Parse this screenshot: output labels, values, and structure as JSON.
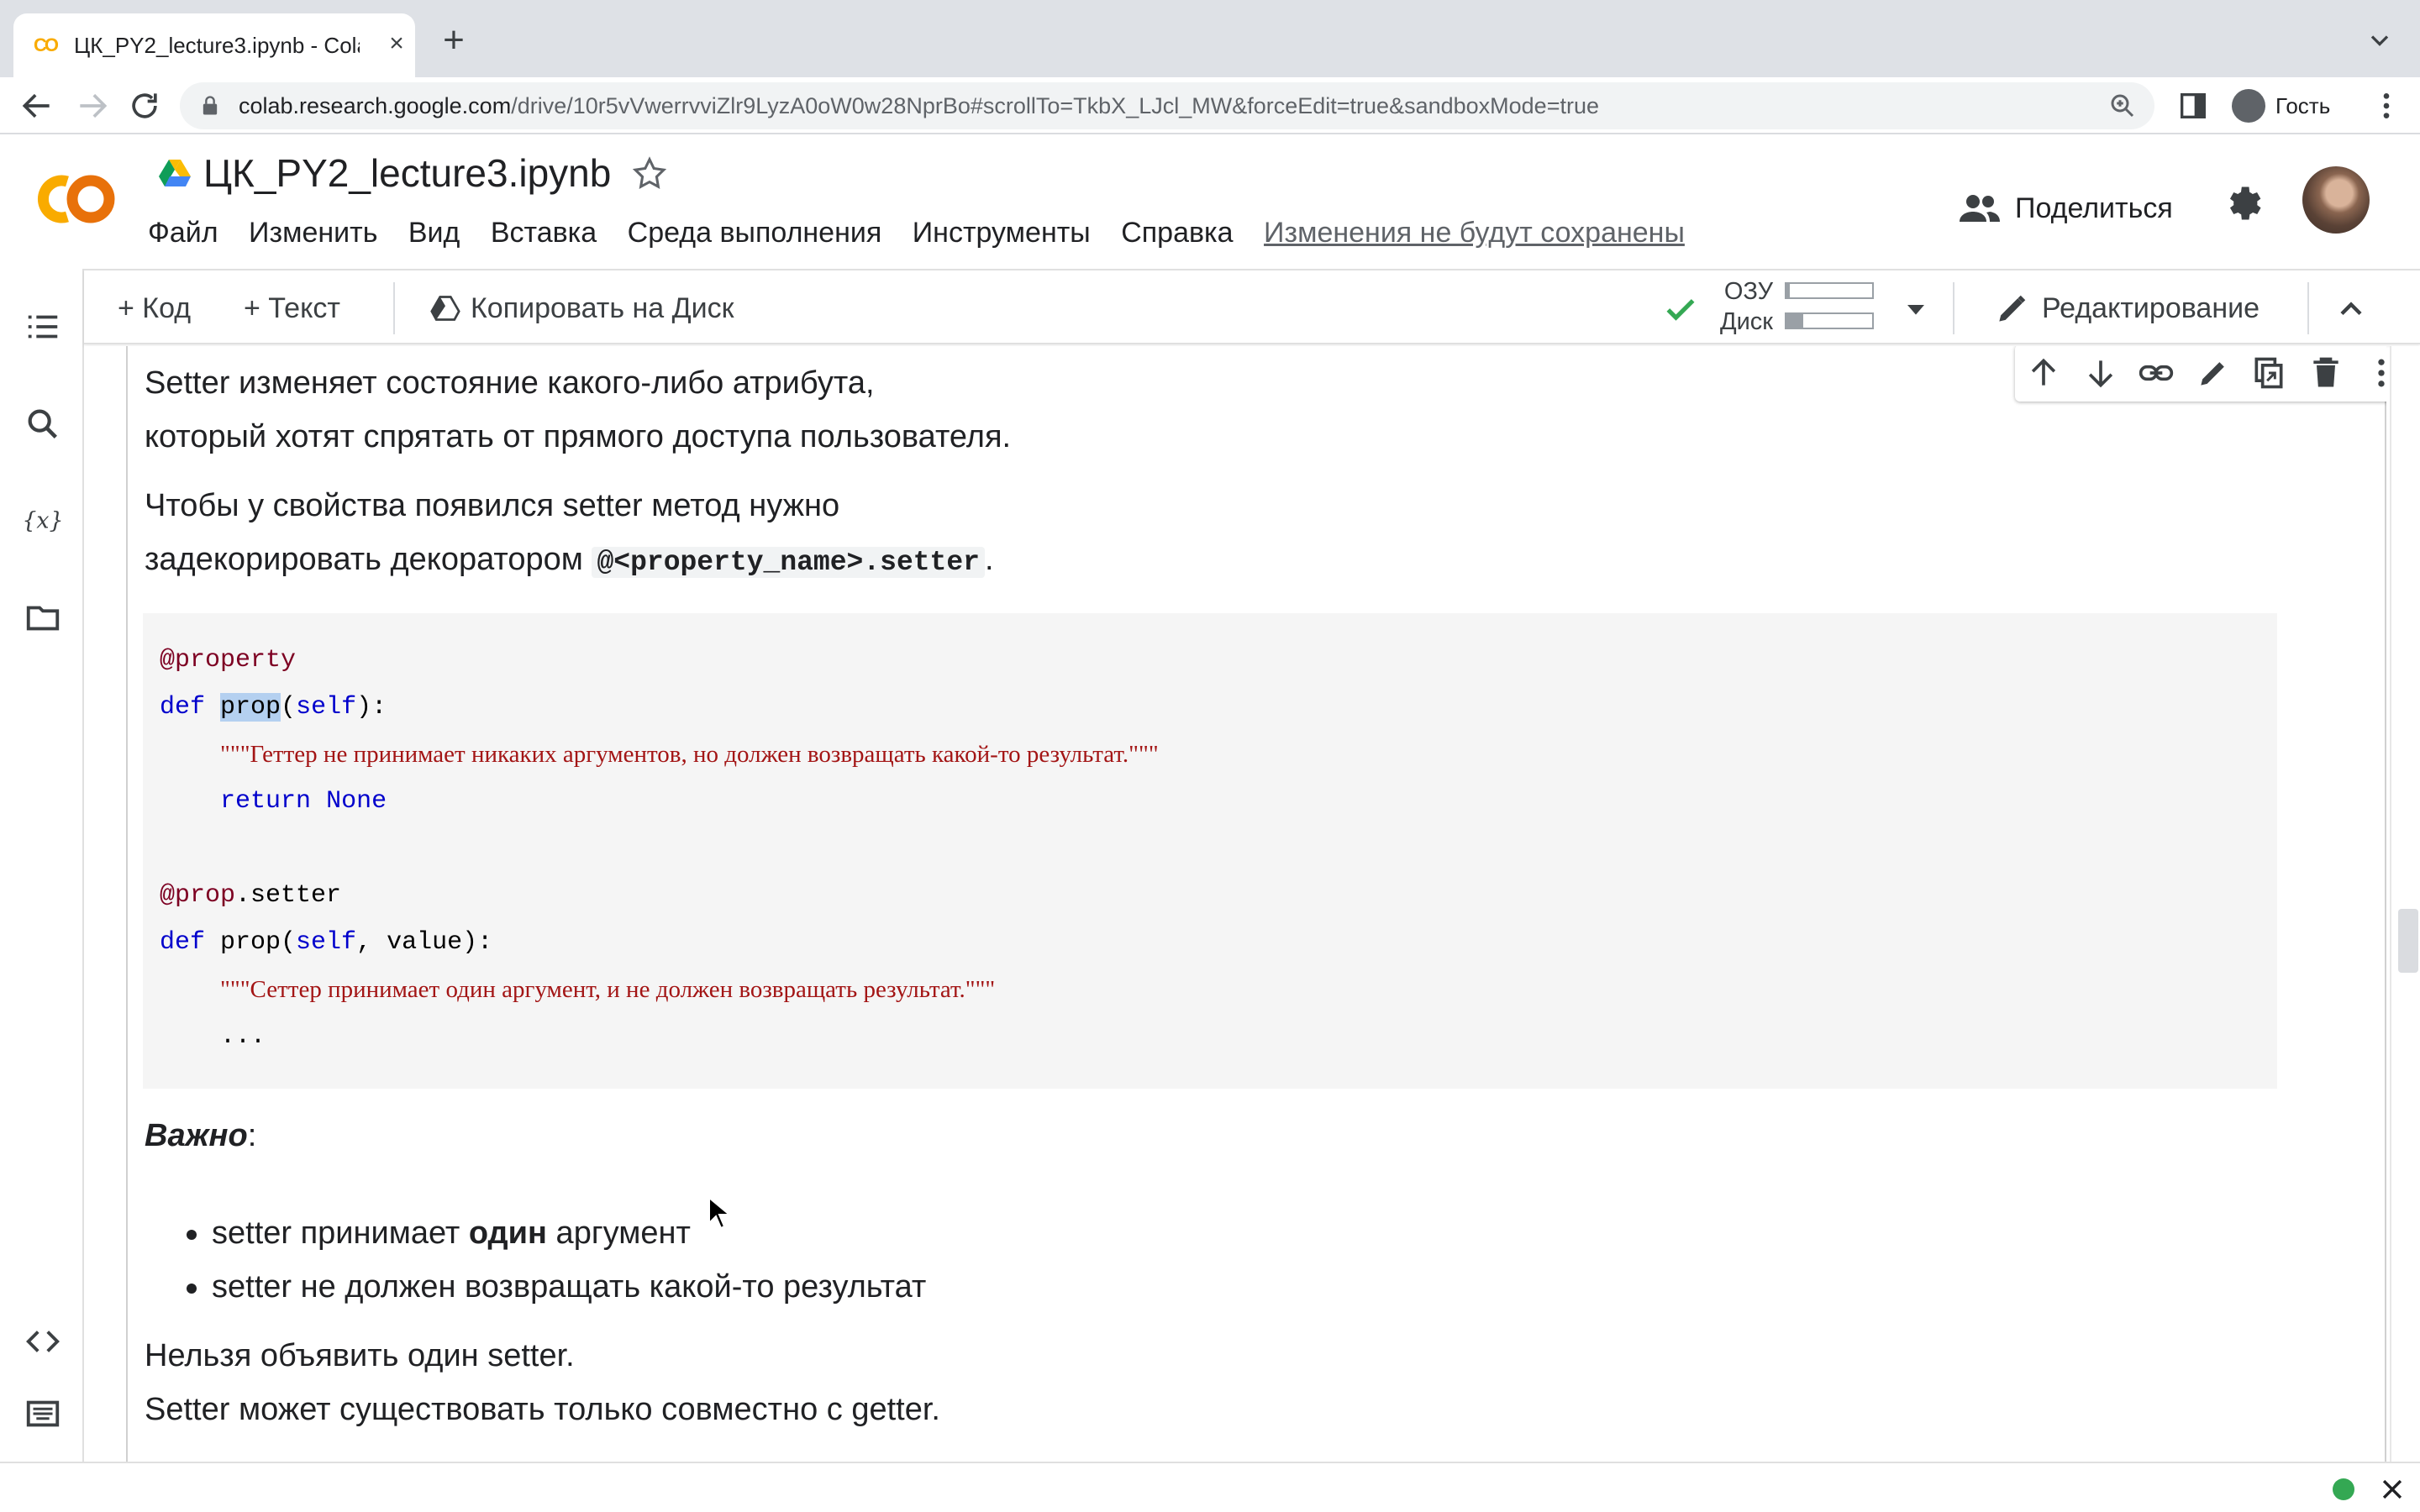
{
  "browser": {
    "tab_title": "ЦК_PY2_lecture3.ipynb - Cola",
    "url_host": "colab.research.google.com",
    "url_path": "/drive/10r5vVwerrvviZlr9LyzA0oW0w28NprBo#scrollTo=TkbX_LJcl_MW&forceEdit=true&sandboxMode=true",
    "profile_label": "Гость"
  },
  "colab": {
    "logo_text": "CO",
    "notebook_title": "ЦК_PY2_lecture3.ipynb",
    "menu": [
      "Файл",
      "Изменить",
      "Вид",
      "Вставка",
      "Среда выполнения",
      "Инструменты",
      "Справка"
    ],
    "unsaved_notice": "Изменения не будут сохранены",
    "share_label": "Поделиться"
  },
  "toolbar": {
    "add_code": "+ Код",
    "add_text": "+ Текст",
    "copy_to_drive": "Копировать на Диск",
    "ram_label": "ОЗУ",
    "disk_label": "Диск",
    "ram_usage": 0.04,
    "disk_usage": 0.2,
    "edit_mode": "Редактирование"
  },
  "cell": {
    "p1_line1": "Setter изменяет состояние какого-либо атрибута,",
    "p1_line2": "который хотят спрятать от прямого доступа пользователя.",
    "p2_line1": "Чтобы у свойства появился setter метод нужно",
    "p2_line2_prefix": "задекорировать декоратором ",
    "p2_code": "@<property_name>.setter",
    "p2_suffix": ".",
    "code": {
      "l1_deco": "@property",
      "l2_def": "def",
      "l2_name": "prop",
      "l2_paren_open": "(",
      "l2_self": "self",
      "l2_rest": "):",
      "l3_doc": "\"\"\"Геттер не принимает никаких аргументов, но должен возвращать какой-то результат.\"\"\"",
      "l4_return": "return",
      "l4_none": "None",
      "l6_deco": "@prop",
      "l6_rest": ".setter",
      "l7_def": "def",
      "l7_name": "prop(",
      "l7_self": "self",
      "l7_rest": ", value):",
      "l8_doc": "\"\"\"Сеттер принимает один аргумент, и не должен возвращать результат.\"\"\"",
      "l9_ellipsis": "..."
    },
    "important_label": "Важно",
    "important_colon": ":",
    "bullet1_pre": "setter принимает ",
    "bullet1_bold": "один",
    "bullet1_post": " аргумент",
    "bullet2": "setter не должен возвращать какой-то результат",
    "p3_line1": "Нельзя объявить один setter.",
    "p3_line2": "Setter может существовать только совместно с getter."
  }
}
